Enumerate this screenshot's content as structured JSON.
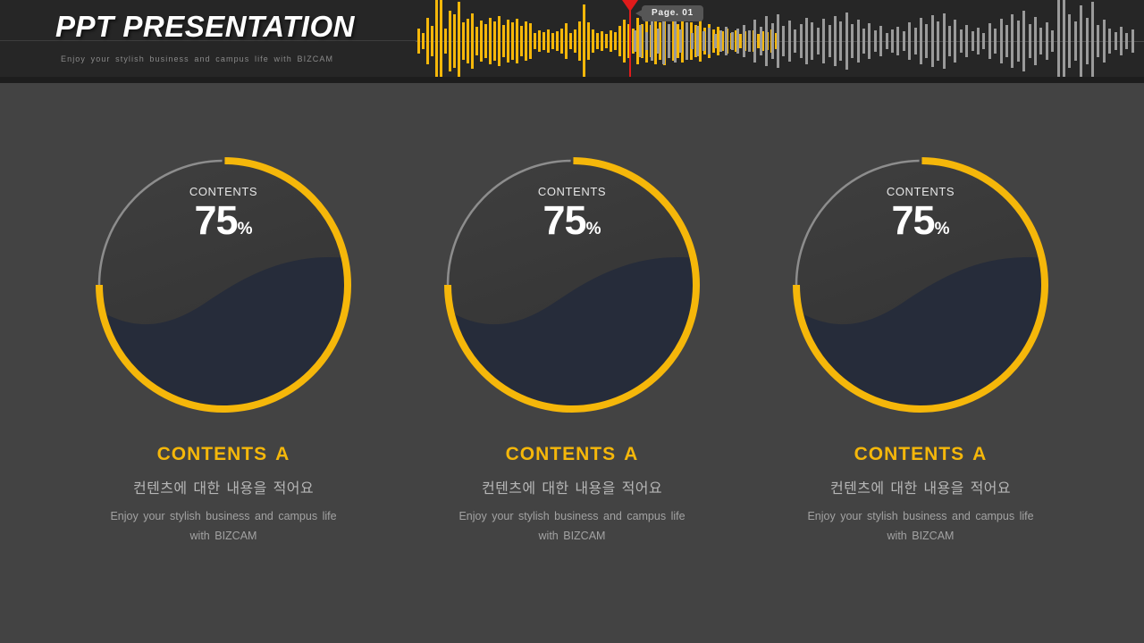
{
  "header": {
    "title": "PPT PRESENTATION",
    "subtitle": "Enjoy your stylish business and campus life with BIZCAM",
    "page_tag": "Page. 01",
    "playhead_color": "#e01b1b",
    "played_color": "#f5b70a",
    "unplayed_color": "#9a9a9a",
    "background": "#262626"
  },
  "theme": {
    "page_background": "#434343",
    "accent": "#f5b70a",
    "wave_fill": "#262c3a",
    "track": "#8d8d8d",
    "dial_face": "#3a3a3a"
  },
  "chart_data": {
    "type": "pie",
    "title": "CONTENTS",
    "xlabel": "",
    "ylabel": "",
    "unit": "%",
    "ylim": [
      0,
      100
    ],
    "categories": [
      "CONTENTS A",
      "CONTENTS A",
      "CONTENTS A"
    ],
    "values": [
      75,
      75,
      75
    ],
    "series": [
      {
        "name": "CONTENTS A",
        "values": [
          75
        ]
      },
      {
        "name": "CONTENTS A",
        "values": [
          75
        ]
      },
      {
        "name": "CONTENTS A",
        "values": [
          75
        ]
      }
    ],
    "legend": "none",
    "grid": false
  },
  "cards": [
    {
      "gauge_label": "CONTENTS",
      "value": "75",
      "percent_symbol": "%",
      "percent": 75,
      "title": "CONTENTS A",
      "korean": "컨텐츠에 대한 내용을 적어요",
      "description": "Enjoy your stylish business and campus life with BIZCAM"
    },
    {
      "gauge_label": "CONTENTS",
      "value": "75",
      "percent_symbol": "%",
      "percent": 75,
      "title": "CONTENTS A",
      "korean": "컨텐츠에 대한 내용을 적어요",
      "description": "Enjoy your stylish business and campus life with BIZCAM"
    },
    {
      "gauge_label": "CONTENTS",
      "value": "75",
      "percent_symbol": "%",
      "percent": 75,
      "title": "CONTENTS A",
      "korean": "컨텐츠에 대한 내용을 적어요",
      "description": "Enjoy your stylish business and campus life with BIZCAM"
    }
  ],
  "waveform": {
    "left_bar_heights": [
      14,
      9,
      26,
      17,
      46,
      60,
      14,
      34,
      30,
      44,
      21,
      25,
      31,
      16,
      23,
      19,
      26,
      22,
      28,
      18,
      24,
      21,
      25,
      17,
      22,
      20,
      9,
      12,
      10,
      13,
      9,
      11,
      14,
      20,
      9,
      13,
      22,
      41,
      21,
      13,
      9,
      11,
      8,
      12,
      10,
      17,
      24,
      19,
      14,
      26,
      19,
      24,
      18,
      26,
      21,
      27,
      16,
      22,
      19,
      24,
      16,
      21,
      18,
      23,
      15,
      19,
      13,
      16,
      11,
      14,
      9,
      12,
      8,
      11,
      9,
      12,
      8,
      11,
      10,
      13,
      9
    ],
    "right_bar_heights": [
      12,
      18,
      10,
      22,
      14,
      26,
      19,
      24,
      13,
      21,
      9,
      17,
      11,
      15,
      8,
      12,
      16,
      10,
      14,
      18,
      12,
      24,
      16,
      28,
      20,
      30,
      17,
      23,
      13,
      19,
      26,
      21,
      15,
      25,
      18,
      28,
      22,
      32,
      19,
      24,
      14,
      20,
      12,
      17,
      9,
      13,
      16,
      11,
      21,
      15,
      26,
      19,
      29,
      22,
      31,
      17,
      24,
      13,
      18,
      11,
      15,
      9,
      20,
      14,
      25,
      18,
      30,
      23,
      34,
      19,
      27,
      15,
      21,
      12,
      46,
      58,
      30,
      22,
      40,
      26,
      44,
      18,
      24,
      14,
      10,
      16,
      9,
      13
    ]
  }
}
